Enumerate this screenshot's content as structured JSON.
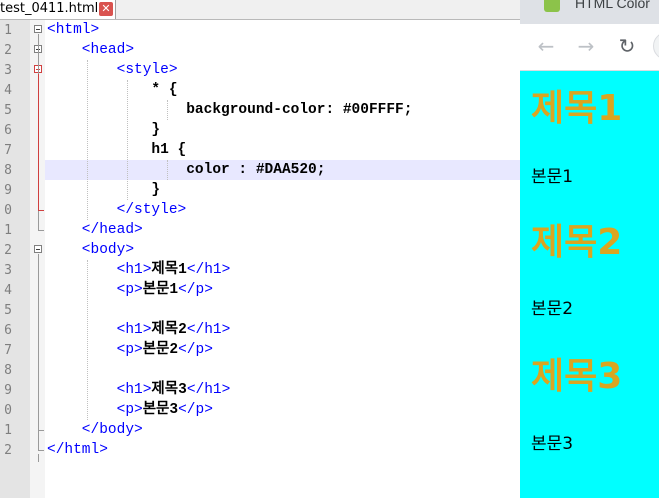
{
  "editor": {
    "tab": {
      "label": "test_0411.html",
      "close_icon": "close-icon"
    },
    "line_numbers": [
      "1",
      "2",
      "3",
      "4",
      "5",
      "6",
      "7",
      "8",
      "9",
      "0",
      "1",
      "2",
      "3",
      "4",
      "5",
      "6",
      "7",
      "8",
      "9",
      "0",
      "1",
      "2"
    ],
    "lines": [
      {
        "parts": [
          {
            "t": "<html>",
            "c": "tag"
          }
        ]
      },
      {
        "parts": [
          {
            "t": "    <head>",
            "c": "tag"
          }
        ]
      },
      {
        "parts": [
          {
            "t": "        <style>",
            "c": "tag"
          }
        ]
      },
      {
        "parts": [
          {
            "t": "            * {",
            "c": "prop"
          }
        ]
      },
      {
        "parts": [
          {
            "t": "                background-color: #00FFFF;",
            "c": "prop"
          }
        ]
      },
      {
        "parts": [
          {
            "t": "            }",
            "c": "prop"
          }
        ]
      },
      {
        "parts": [
          {
            "t": "            h1 {",
            "c": "prop"
          }
        ]
      },
      {
        "parts": [
          {
            "t": "                color : #DAA520;",
            "c": "prop"
          }
        ]
      },
      {
        "parts": [
          {
            "t": "            }",
            "c": "prop"
          }
        ]
      },
      {
        "parts": [
          {
            "t": "        </style>",
            "c": "tag"
          }
        ]
      },
      {
        "parts": [
          {
            "t": "    </head>",
            "c": "tag"
          }
        ]
      },
      {
        "parts": [
          {
            "t": "    <body>",
            "c": "tag"
          }
        ]
      },
      {
        "parts": [
          {
            "t": "        <h1>",
            "c": "tag"
          },
          {
            "t": "제목1",
            "c": "txt"
          },
          {
            "t": "</h1>",
            "c": "tag"
          }
        ]
      },
      {
        "parts": [
          {
            "t": "        <p>",
            "c": "tag"
          },
          {
            "t": "본문1",
            "c": "txt"
          },
          {
            "t": "</p>",
            "c": "tag"
          }
        ]
      },
      {
        "parts": []
      },
      {
        "parts": [
          {
            "t": "        <h1>",
            "c": "tag"
          },
          {
            "t": "제목2",
            "c": "txt"
          },
          {
            "t": "</h1>",
            "c": "tag"
          }
        ]
      },
      {
        "parts": [
          {
            "t": "        <p>",
            "c": "tag"
          },
          {
            "t": "본문2",
            "c": "txt"
          },
          {
            "t": "</p>",
            "c": "tag"
          }
        ]
      },
      {
        "parts": []
      },
      {
        "parts": [
          {
            "t": "        <h1>",
            "c": "tag"
          },
          {
            "t": "제목3",
            "c": "txt"
          },
          {
            "t": "</h1>",
            "c": "tag"
          }
        ]
      },
      {
        "parts": [
          {
            "t": "        <p>",
            "c": "tag"
          },
          {
            "t": "본문3",
            "c": "txt"
          },
          {
            "t": "</p>",
            "c": "tag"
          }
        ]
      },
      {
        "parts": [
          {
            "t": "    </body>",
            "c": "tag"
          }
        ]
      },
      {
        "parts": [
          {
            "t": "</html>",
            "c": "tag"
          }
        ]
      }
    ],
    "current_line": 8
  },
  "browser": {
    "title": "HTML Color",
    "nav": {
      "back_icon": "back-arrow-icon",
      "forward_icon": "forward-arrow-icon",
      "reload_icon": "reload-icon"
    },
    "content": {
      "heading_color": "#DAA520",
      "background_color": "#00FFFF",
      "items": [
        {
          "h1": "제목1",
          "p": "본문1"
        },
        {
          "h1": "제목2",
          "p": "본문2"
        },
        {
          "h1": "제목3",
          "p": "본문3"
        }
      ]
    }
  }
}
